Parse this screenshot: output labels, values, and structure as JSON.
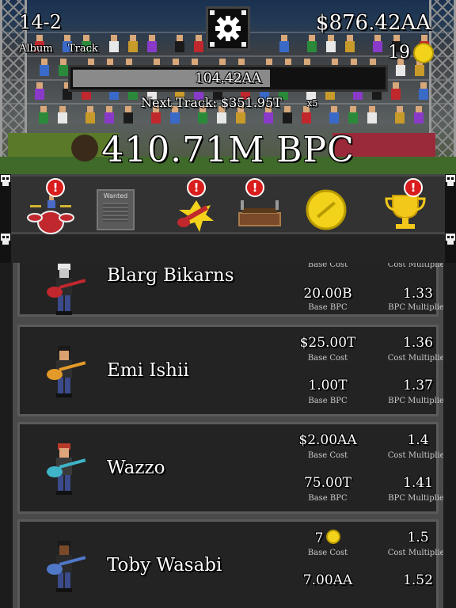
{
  "hud": {
    "album_track": "14-2",
    "album_label": "Album",
    "track_label": "Track",
    "money": "$876.42AA",
    "coins": "19",
    "progress_text": "104.42AA",
    "progress_fraction": 0.68,
    "next_track": "Next Track: $351.95T",
    "next_track_sub": "x5",
    "bpc": "410.71M BPC"
  },
  "toolbar": {
    "tools": [
      {
        "name": "band",
        "icon": "drum-kit-icon",
        "alert": true
      },
      {
        "name": "wanted",
        "icon": "wanted-poster-icon",
        "alert": false,
        "text": "Wanted"
      },
      {
        "name": "instruments",
        "icon": "guitar-burst-icon",
        "alert": true
      },
      {
        "name": "stage",
        "icon": "stage-icon",
        "alert": true
      },
      {
        "name": "coins",
        "icon": "gold-coin-icon",
        "alert": false
      },
      {
        "name": "achievements",
        "icon": "trophy-icon",
        "alert": true
      }
    ],
    "alert_glyph": "!"
  },
  "musicians": [
    {
      "name": "Blarg Bikarns",
      "base_cost": "",
      "cost_multiplier": "",
      "base_bpc": "20.00B",
      "bpc_multiplier": "1.33",
      "skin": "#c9c9c9",
      "shirt": "#2b2b2b",
      "guitar": "#c0282d",
      "hair": "#e8e8e8"
    },
    {
      "name": "Emi Ishii",
      "base_cost": "$25.00T",
      "cost_multiplier": "1.36",
      "base_bpc": "1.00T",
      "bpc_multiplier": "1.37",
      "skin": "#d9a070",
      "shirt": "#2f2f2f",
      "guitar": "#e39a2a",
      "hair": "#1a1a1a"
    },
    {
      "name": "Wazzo",
      "base_cost": "$2.00AA",
      "cost_multiplier": "1.4",
      "base_bpc": "75.00T",
      "bpc_multiplier": "1.41",
      "skin": "#e0a47a",
      "shirt": "#3a3a3a",
      "guitar": "#3fb4c8",
      "hair": "#b83a2a"
    },
    {
      "name": "Toby Wasabi",
      "base_cost": "7",
      "cost_multiplier": "1.5",
      "base_bpc": "7.00AA",
      "bpc_multiplier": "1.52",
      "skin": "#7a4a2a",
      "shirt": "#2a2a2a",
      "guitar": "#4f78c8",
      "hair": "#1a1a1a"
    }
  ],
  "labels": {
    "base_cost": "Base Cost",
    "cost_multiplier": "Cost Multiplier",
    "base_bpc": "Base BPC",
    "bpc_multiplier": "BPC Multiplier"
  },
  "colors": {
    "coin": "#f2d21a",
    "alert": "#d91c1c",
    "card": "#232323"
  }
}
